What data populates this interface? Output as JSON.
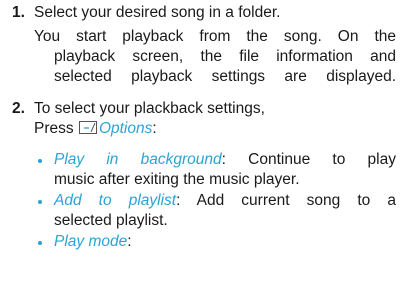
{
  "steps": [
    {
      "number": "1.",
      "title": "Select your desired song in a folder.",
      "lines": [
        "You start playback from the song. On the",
        "playback screen, the file information and",
        "selected playback settings are displayed."
      ]
    },
    {
      "number": "2.",
      "title": "To select your plackback settings,",
      "press_prefix": "Press",
      "softkey_icon": "right-softkey-icon",
      "options_label": "Options",
      "options_suffix": ":",
      "bullets": [
        {
          "term": "Play in background",
          "desc_line1": ": Continue to play",
          "desc_line2": "music after exiting the music player."
        },
        {
          "term": "Add to playlist",
          "desc_line1": ": Add current song to a",
          "desc_line2": "selected playlist."
        },
        {
          "term": "Play mode",
          "desc_line1": ":",
          "desc_line2": ""
        }
      ]
    }
  ],
  "colors": {
    "accent": "#2ba3d6",
    "text": "#1a1a1a"
  }
}
